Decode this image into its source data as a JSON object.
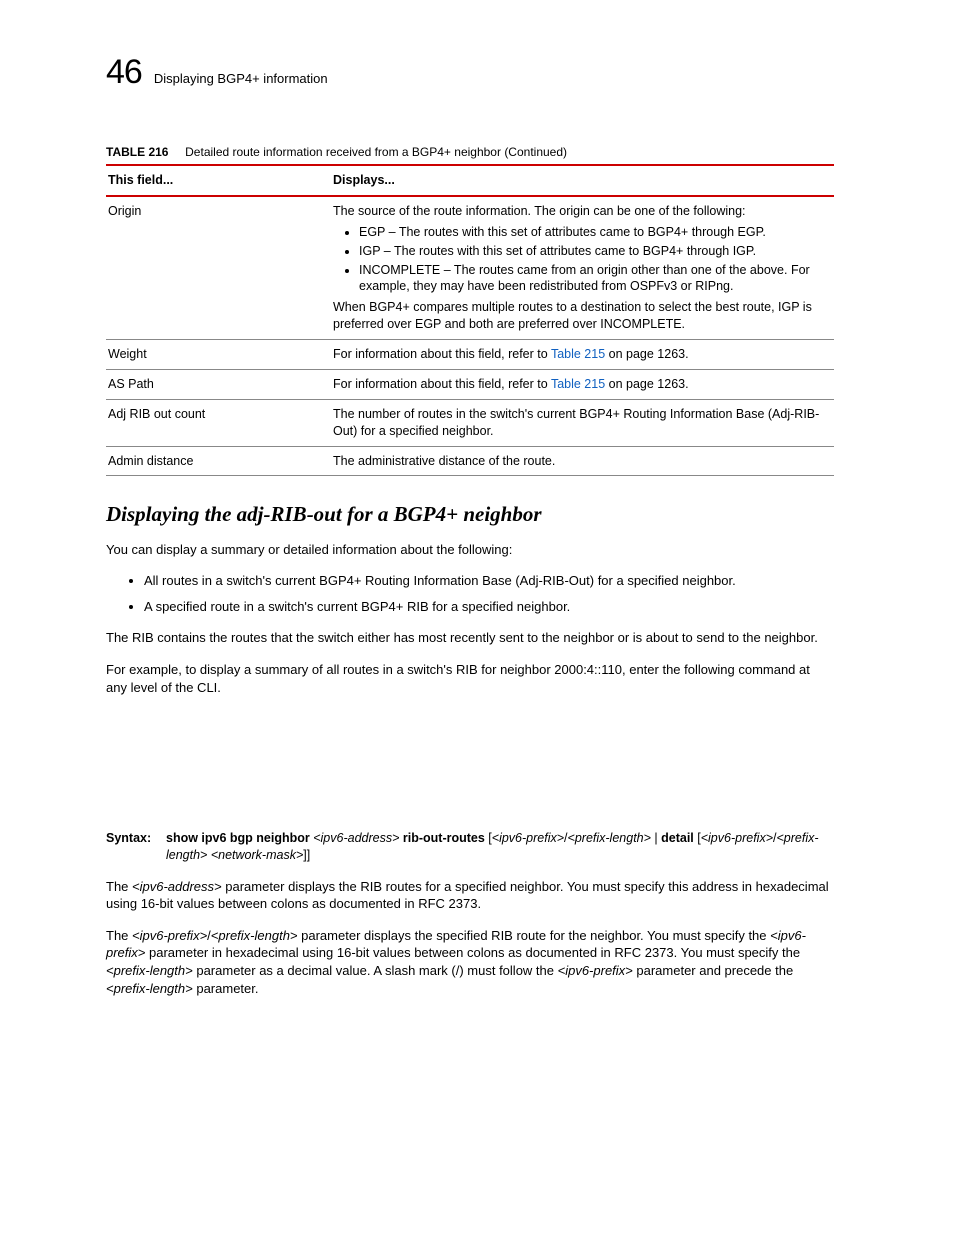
{
  "header": {
    "chapter_number": "46",
    "chapter_title": "Displaying BGP4+ information"
  },
  "table": {
    "label": "TABLE 216",
    "caption": "Detailed route information received from a BGP4+ neighbor  (Continued)",
    "head_col1": "This field...",
    "head_col2": "Displays...",
    "rows": {
      "origin": {
        "field": "Origin",
        "intro": "The source of the route information. The origin can be one of the following:",
        "b1": "EGP – The routes with this set of attributes came to BGP4+ through EGP.",
        "b2": "IGP – The routes with this set of attributes came to BGP4+ through IGP.",
        "b3": "INCOMPLETE – The routes came from an origin other than one of the above. For example, they may have been redistributed from OSPFv3 or RIPng.",
        "trailer": "When BGP4+ compares multiple routes to a destination to select the best route, IGP is preferred over EGP and both are preferred over INCOMPLETE."
      },
      "weight": {
        "field": "Weight",
        "pre": "For information about this field, refer to ",
        "link": "Table 215",
        "post": " on page 1263."
      },
      "aspath": {
        "field": "AS Path",
        "pre": "For information about this field, refer to ",
        "link": "Table 215",
        "post": " on page 1263."
      },
      "adjrib": {
        "field": "Adj RIB out count",
        "desc": "The number of routes in the switch's current BGP4+ Routing Information Base (Adj-RIB-Out) for a specified neighbor."
      },
      "admin": {
        "field": "Admin distance",
        "desc": "The administrative distance of the route."
      }
    }
  },
  "section": {
    "heading": "Displaying the adj-RIB-out for a BGP4+ neighbor",
    "p1": "You can display a summary or detailed information about the following:",
    "li1": "All routes in a switch's current BGP4+ Routing Information Base (Adj-RIB-Out) for a specified neighbor.",
    "li2": "A specified route in a switch's current BGP4+ RIB for a specified neighbor.",
    "p2": "The RIB contains the routes that the switch either has most recently sent to the neighbor or is about to send to the neighbor.",
    "p3": "For example, to display a summary of all routes in a switch's RIB for neighbor 2000:4::110, enter the following command at any level of the CLI."
  },
  "syntax": {
    "label": "Syntax:",
    "cmd1": "show ipv6 bgp neighbor",
    "arg1": "<ipv6-address>",
    "cmd2": "rib-out-routes",
    "arg2a": "<ipv6-prefix>",
    "arg2b": "<prefix-length>",
    "cmd3": "detail",
    "arg3a": "<ipv6-prefix>",
    "arg3b": "<prefix-length>",
    "arg3c": "<network-mask>"
  },
  "para_addr_a": "The ",
  "para_addr_param": "<ipv6-address>",
  "para_addr_b": " parameter displays the RIB routes for a specified neighbor. You must specify this address in hexadecimal using 16-bit values between colons as documented in RFC 2373.",
  "para_pref_a": "The ",
  "para_pref_p1": "<ipv6-prefix>",
  "para_pref_slash": "/",
  "para_pref_p2": "<prefix-length>",
  "para_pref_b": " parameter displays the specified RIB route for the neighbor. You must specify the ",
  "para_pref_p3": "<ipv6-prefix>",
  "para_pref_c": " parameter in hexadecimal using 16-bit values between colons as documented in RFC 2373. You must specify the ",
  "para_pref_p4": "<prefix-length>",
  "para_pref_d": " parameter as a decimal value. A slash mark (/) must follow the ",
  "para_pref_p5": "<ipv6-prefix>",
  "para_pref_e": " parameter and precede the ",
  "para_pref_p6": "<prefix-length>",
  "para_pref_f": " parameter."
}
